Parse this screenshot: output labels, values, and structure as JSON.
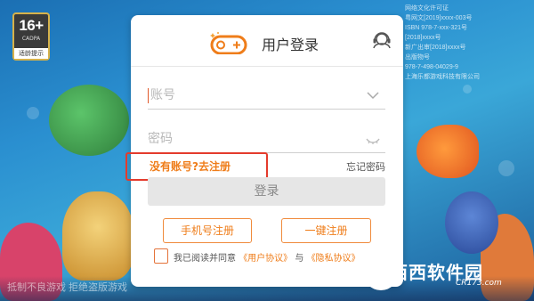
{
  "background": {
    "right_text": [
      "网络文化许可证",
      "粤网文[2019]xxxx-003号",
      "ISBN 978-7-xxx-321号",
      "[2018]xxxx号",
      "新广出审[2018]xxxx号",
      "出版物号",
      "978-7-498-04029-9",
      "上海乐都游戏科技有限公司"
    ],
    "bottom_text": "抵制不良游戏 拒绝盗版游戏"
  },
  "age_badge": {
    "rating": "16+",
    "sub": "CADPA",
    "tip": "适龄提示"
  },
  "dialog": {
    "title": "用户登录",
    "account_placeholder": "账号",
    "password_placeholder": "密码",
    "register_link": "没有账号?去注册",
    "forgot_link": "忘记密码",
    "login_button": "登录",
    "phone_register_button": "手机号注册",
    "quick_register_button": "一键注册",
    "agreement": {
      "prefix": "我已阅读并同意",
      "user_agreement": "《用户协议》",
      "conjunction": "与",
      "privacy_agreement": "《隐私协议》"
    }
  },
  "watermark": {
    "main": "西西软件园",
    "sub": "CR173.com"
  },
  "colors": {
    "accent": "#ef7d1a",
    "highlight_border": "#e43b2c",
    "button_disabled": "#e6e6e6"
  }
}
